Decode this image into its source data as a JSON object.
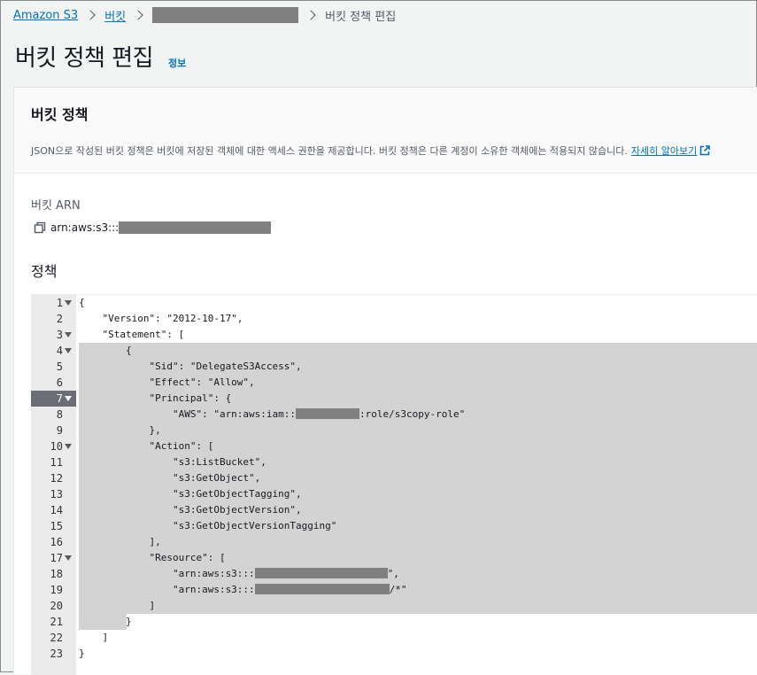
{
  "breadcrumb": {
    "home": "Amazon S3",
    "buckets": "버킷",
    "current": "버킷 정책 편집"
  },
  "page": {
    "title": "버킷 정책 편집",
    "info": "정보"
  },
  "panel": {
    "title": "버킷 정책",
    "description": "JSON으로 작성된 버킷 정책은 버킷에 저장된 객체에 대한 액세스 권한을 제공합니다. 버킷 정책은 다른 계정이 소유한 객체에는 적용되지 않습니다.",
    "learn_more": "자세히 알아보기"
  },
  "arn": {
    "label": "버킷 ARN",
    "prefix": "arn:aws:s3:::"
  },
  "policy": {
    "label": "정책",
    "active_line": 7,
    "lines": [
      {
        "n": 1,
        "fold": true,
        "text": "{"
      },
      {
        "n": 2,
        "fold": false,
        "text": "    \"Version\": \"2012-10-17\","
      },
      {
        "n": 3,
        "fold": true,
        "text": "    \"Statement\": ["
      },
      {
        "n": 4,
        "fold": true,
        "text": "        {"
      },
      {
        "n": 5,
        "fold": false,
        "text": "            \"Sid\": \"DelegateS3Access\","
      },
      {
        "n": 6,
        "fold": false,
        "text": "            \"Effect\": \"Allow\","
      },
      {
        "n": 7,
        "fold": true,
        "text": "            \"Principal\": {"
      },
      {
        "n": 8,
        "fold": false,
        "text": "                \"AWS\": \"arn:aws:iam::",
        "redact_w": 72,
        "after": ":role/s3copy-role\""
      },
      {
        "n": 9,
        "fold": false,
        "text": "            },"
      },
      {
        "n": 10,
        "fold": true,
        "text": "            \"Action\": ["
      },
      {
        "n": 11,
        "fold": false,
        "text": "                \"s3:ListBucket\","
      },
      {
        "n": 12,
        "fold": false,
        "text": "                \"s3:GetObject\","
      },
      {
        "n": 13,
        "fold": false,
        "text": "                \"s3:GetObjectTagging\","
      },
      {
        "n": 14,
        "fold": false,
        "text": "                \"s3:GetObjectVersion\","
      },
      {
        "n": 15,
        "fold": false,
        "text": "                \"s3:GetObjectVersionTagging\""
      },
      {
        "n": 16,
        "fold": false,
        "text": "            ],"
      },
      {
        "n": 17,
        "fold": true,
        "text": "            \"Resource\": ["
      },
      {
        "n": 18,
        "fold": false,
        "text": "                \"arn:aws:s3:::",
        "redact_w": 150,
        "after": "\","
      },
      {
        "n": 19,
        "fold": false,
        "text": "                \"arn:aws:s3:::",
        "redact_w": 152,
        "after": "/*\""
      },
      {
        "n": 20,
        "fold": false,
        "text": "            ]"
      },
      {
        "n": 21,
        "fold": false,
        "text": "        }"
      },
      {
        "n": 22,
        "fold": false,
        "text": "    ]"
      },
      {
        "n": 23,
        "fold": false,
        "text": "}"
      }
    ]
  }
}
